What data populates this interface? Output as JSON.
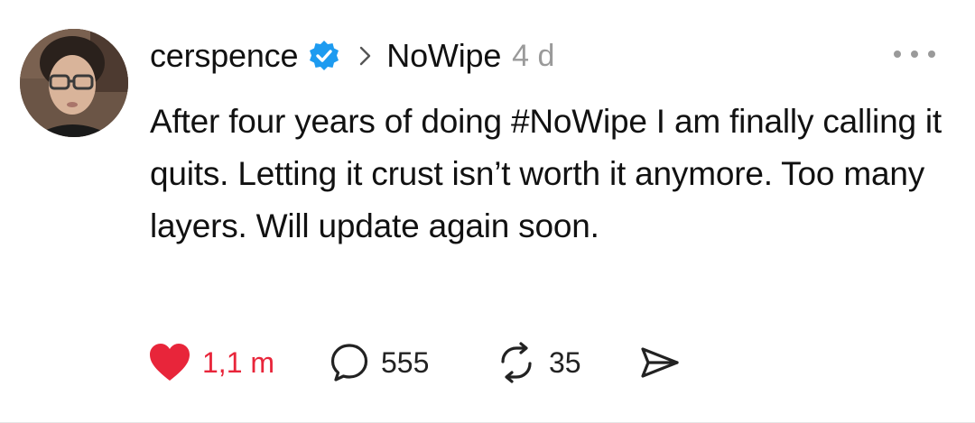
{
  "post": {
    "username": "cerspence",
    "community": "NoWipe",
    "time": "4 d",
    "text": "After four years of doing #NoWipe I am finally calling it quits. Letting it crust isn’t worth it anymore. Too many layers. Will update again soon.",
    "likes": "1,1 m",
    "replies": "555",
    "reposts": "35"
  },
  "icons": {
    "avatar": "avatar",
    "verified": "verified-badge-icon",
    "chevron": "chevron-right-icon",
    "more": "more-icon",
    "like": "heart-icon",
    "reply": "comment-icon",
    "repost": "repost-icon",
    "share": "send-icon"
  },
  "colors": {
    "like": "#e8253a",
    "verified": "#1d9bf0",
    "muted": "#9a9a9a"
  }
}
